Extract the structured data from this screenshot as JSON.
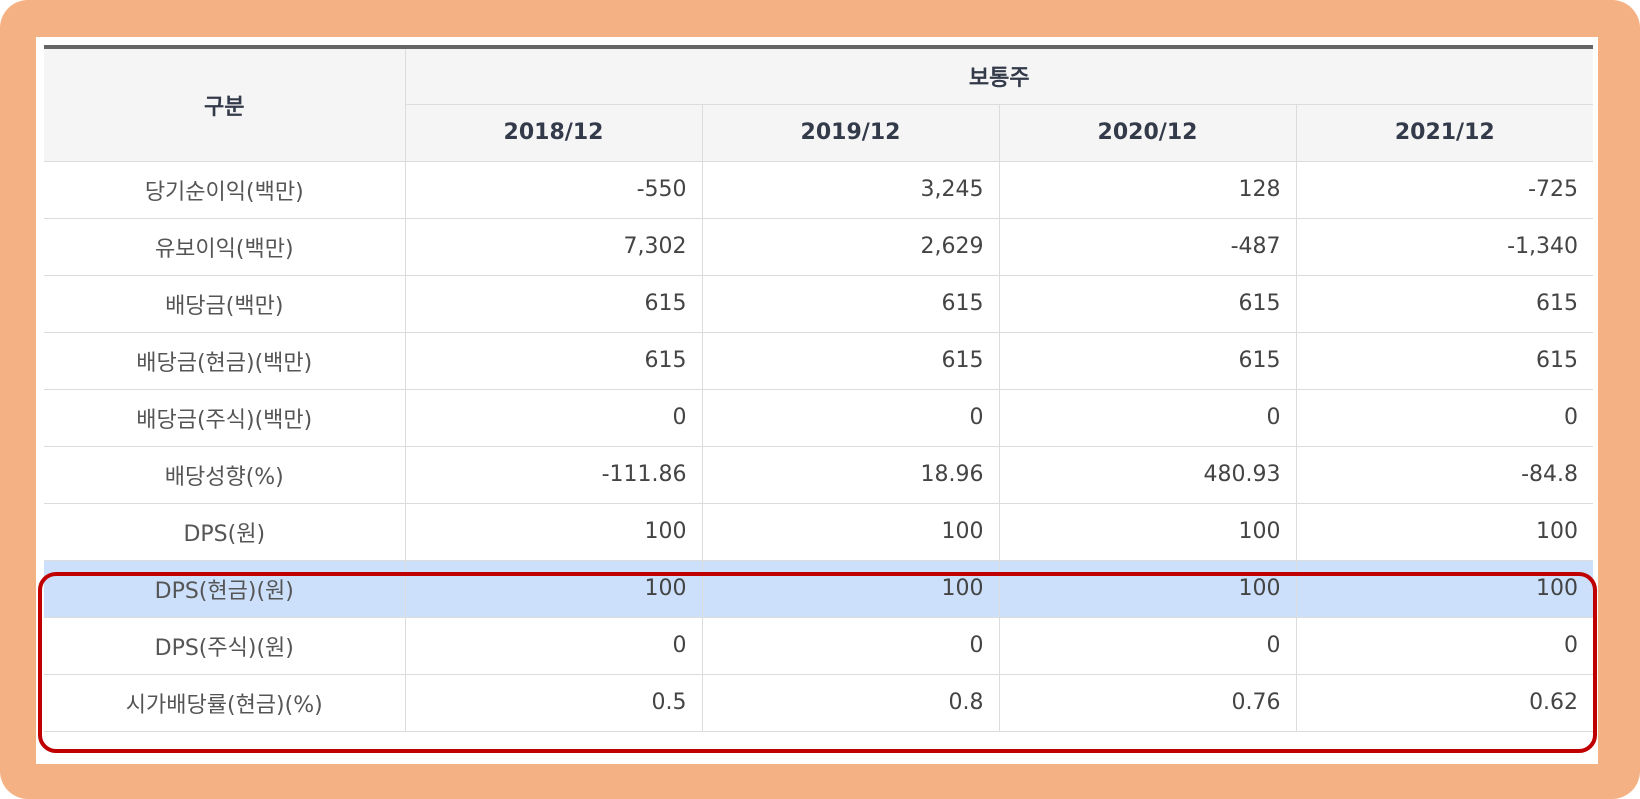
{
  "table": {
    "row_header_label": "구분",
    "group_header": "보통주",
    "years": [
      "2018/12",
      "2019/12",
      "2020/12",
      "2021/12"
    ],
    "rows": [
      {
        "label": "당기순이익(백만)",
        "values": [
          "-550",
          "3,245",
          "128",
          "-725"
        ]
      },
      {
        "label": "유보이익(백만)",
        "values": [
          "7,302",
          "2,629",
          "-487",
          "-1,340"
        ]
      },
      {
        "label": "배당금(백만)",
        "values": [
          "615",
          "615",
          "615",
          "615"
        ]
      },
      {
        "label": "배당금(현금)(백만)",
        "values": [
          "615",
          "615",
          "615",
          "615"
        ]
      },
      {
        "label": "배당금(주식)(백만)",
        "values": [
          "0",
          "0",
          "0",
          "0"
        ]
      },
      {
        "label": "배당성향(%)",
        "values": [
          "-111.86",
          "18.96",
          "480.93",
          "-84.8"
        ]
      },
      {
        "label": "DPS(원)",
        "values": [
          "100",
          "100",
          "100",
          "100"
        ]
      },
      {
        "label": "DPS(현금)(원)",
        "values": [
          "100",
          "100",
          "100",
          "100"
        ]
      },
      {
        "label": "DPS(주식)(원)",
        "values": [
          "0",
          "0",
          "0",
          "0"
        ]
      },
      {
        "label": "시가배당률(현금)(%)",
        "values": [
          "0.5",
          "0.8",
          "0.76",
          "0.62"
        ]
      }
    ]
  },
  "colors": {
    "frame_background": "#f4b183",
    "header_background": "#f5f5f5",
    "selected_row_background": "#cce0fb",
    "highlight_border": "#c00000",
    "top_rule": "#656565"
  }
}
